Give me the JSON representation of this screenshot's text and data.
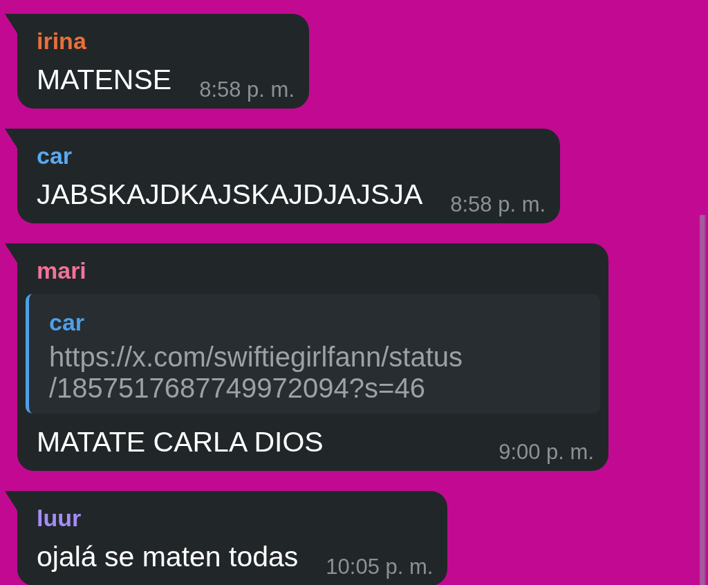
{
  "messages": [
    {
      "sender": "irina",
      "color": "#e8703a",
      "text": "MATENSE",
      "time": "8:58 p. m."
    },
    {
      "sender": "car",
      "color": "#5aa9f2",
      "text": "JABSKAJDKAJSKAJDJAJSJA",
      "time": "8:58 p. m."
    },
    {
      "sender": "mari",
      "color": "#f0729a",
      "quote": {
        "sender": "car",
        "color": "#4f9fe8",
        "lines": [
          "https://x.com/swiftiegirlfann/status",
          "/1857517687749972094?s=46"
        ]
      },
      "text": "MATATE CARLA DIOS",
      "time": "9:00 p. m."
    },
    {
      "sender": "luur",
      "color": "#a68cf5",
      "text": "ojalá se maten todas",
      "time": "10:05 p. m."
    }
  ]
}
